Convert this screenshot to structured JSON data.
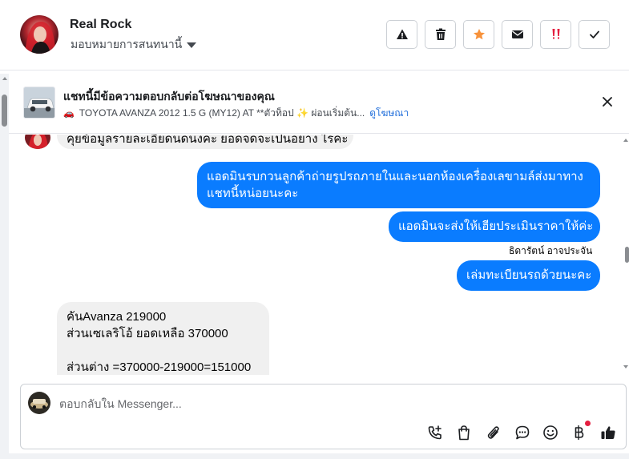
{
  "header": {
    "contact_name": "Real Rock",
    "assign_label": "มอบหมายการสนทนานี้",
    "actions": [
      {
        "name": "report-button",
        "icon": "warning-icon"
      },
      {
        "name": "delete-button",
        "icon": "trash-icon"
      },
      {
        "name": "star-button",
        "icon": "star-icon"
      },
      {
        "name": "mark-unread-button",
        "icon": "envelope-icon"
      },
      {
        "name": "follow-up-button",
        "icon": "follow-up-icon"
      },
      {
        "name": "mark-done-button",
        "icon": "check-icon"
      }
    ]
  },
  "ad_banner": {
    "title": "แชทนี้มีข้อความตอบกลับต่อโฆษณาของคุณ",
    "car_emoji": "🚗",
    "ad_text": "TOYOTA AVANZA 2012 1.5 G (MY12) AT **ตัวท็อป ✨ ผ่อนเริ่มต้น...",
    "view_ad_label": "ดูโฆษณา"
  },
  "messages": {
    "partial_incoming": "คุยข้อมูลรายละเอียดนดนงคะ ยอดจดจะเปนอยาง ไรคะ",
    "out_1": "แอดมินรบกวนลูกค้าถ่ายรูปรถภายในและนอกห้องเครื่องเลขามล์ส่งมาทาง\nแชทนี้หน่อยนะคะ",
    "out_2": "แอดมินจะส่งให้เฮียประเมินราคาให้ค่ะ",
    "sender": "ธิดารัตน์ อาจประจัน",
    "out_3": "เล่มทะเบียนรถด้วยนะคะ",
    "in_1": "คันAvanza 219000\nส่วนเซเลริโอ้ ยอดเหลือ 370000\n\nส่วนต่าง =370000-219000=151000"
  },
  "composer": {
    "placeholder": "ตอบกลับใน Messenger...",
    "tools": [
      "call-add-icon",
      "shopping-bag-icon",
      "paperclip-icon",
      "saved-reply-icon",
      "emoji-icon",
      "baht-icon",
      "thumbs-up-icon"
    ]
  },
  "colors": {
    "accent": "#0a7cff",
    "incoming_bubble": "#f0f0f0",
    "star": "#f7923b",
    "follow_up": "#e41e3f"
  }
}
